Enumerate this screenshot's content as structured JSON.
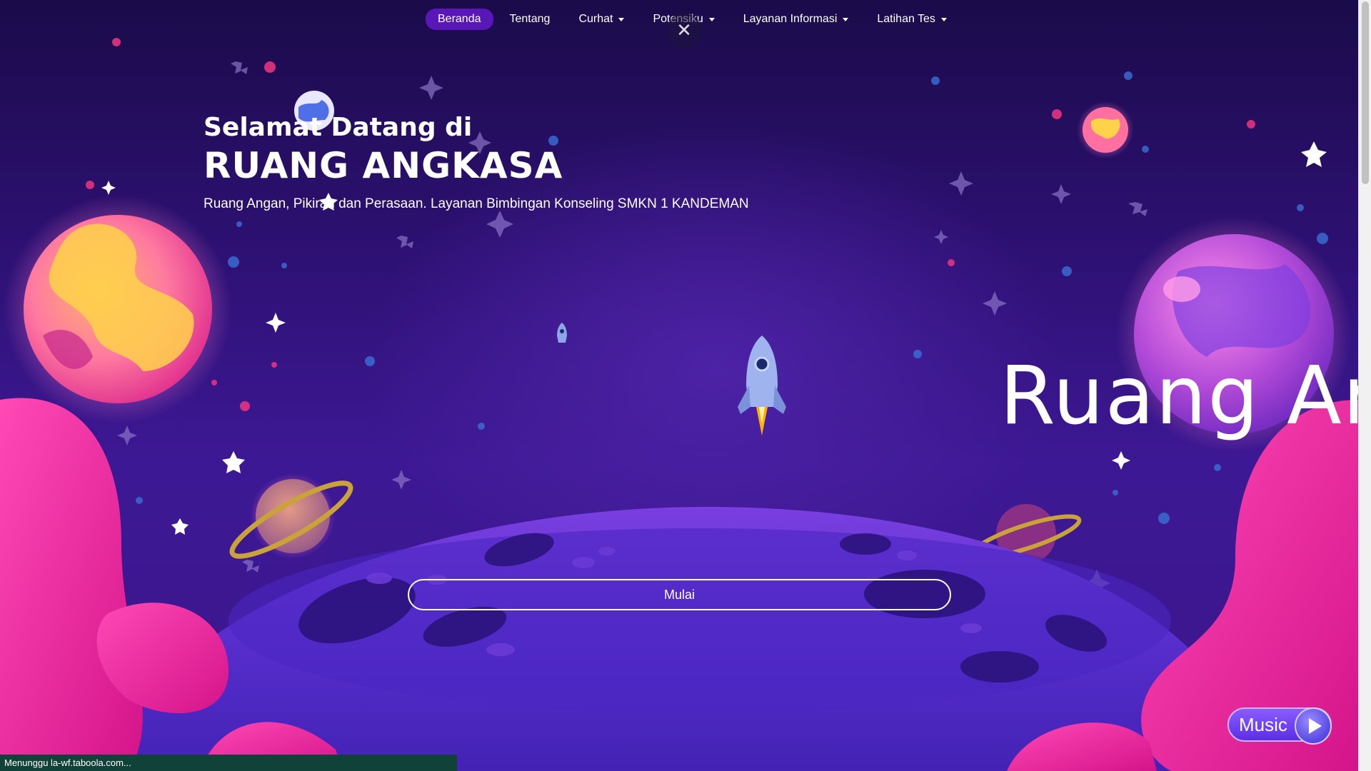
{
  "navbar": {
    "items": [
      {
        "label": "Beranda",
        "active": true,
        "dropdown": false
      },
      {
        "label": "Tentang",
        "active": false,
        "dropdown": false
      },
      {
        "label": "Curhat",
        "active": false,
        "dropdown": true
      },
      {
        "label": "Potensiku",
        "active": false,
        "dropdown": true
      },
      {
        "label": "Layanan Informasi",
        "active": false,
        "dropdown": true
      },
      {
        "label": "Latihan Tes",
        "active": false,
        "dropdown": true
      }
    ],
    "close_icon": "close-icon"
  },
  "hero": {
    "pre_title": "Selamat Datang di",
    "title": "RUANG ANGKASA",
    "subtitle": "Ruang Angan, Pikiran dan Perasaan. Layanan Bimbingan Konseling SMKN 1 KANDEMAN"
  },
  "marquee": {
    "text": "Ruang An"
  },
  "start_button": {
    "label": "Mulai"
  },
  "music_button": {
    "label": "Music",
    "icon": "play-icon"
  },
  "status_bar": {
    "text": "Menunggu la-wf.taboola.com..."
  },
  "colors": {
    "background": "#2a1266",
    "nav_active": "#5a17b8",
    "moon": "#5a2fd0",
    "hill_pink": "#ff2fa8",
    "status_bar": "#11423a"
  }
}
